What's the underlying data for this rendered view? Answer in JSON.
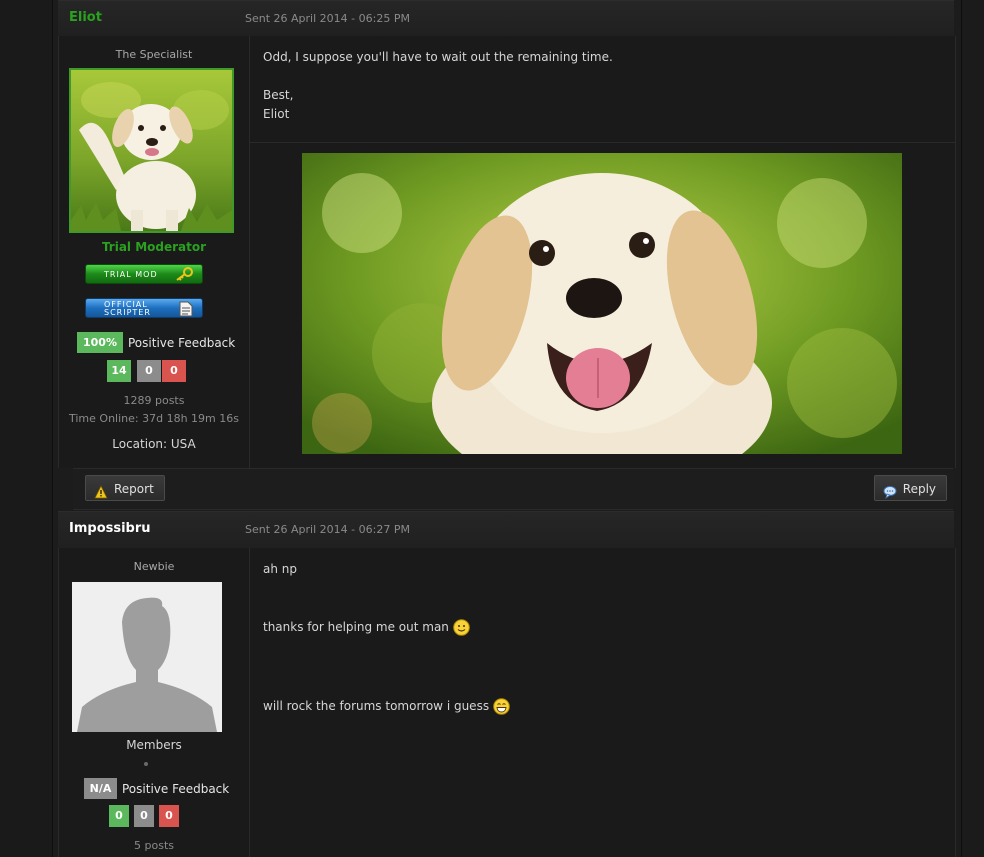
{
  "posts": [
    {
      "author": "Eliot",
      "author_color": "#2aa11f",
      "sent": "Sent 26 April 2014 - 06:25 PM",
      "user_title": "The Specialist",
      "group": "Trial Moderator",
      "group_color": "#2aa11f",
      "badges": [
        "TRIAL MOD",
        "OFFICIAL SCRIPTER"
      ],
      "feedback_pct": "100%",
      "feedback_label": "Positive Feedback",
      "rep_positive": "14",
      "rep_neutral": "0",
      "rep_negative": "0",
      "posts_count": "1289 posts",
      "time_online": "Time Online: 37d 18h 19m 16s",
      "location": "Location: USA",
      "message": "Odd, I suppose you'll have to wait out the remaining time.\n\nBest,\nEliot",
      "buttons": {
        "report": "Report",
        "reply": "Reply"
      }
    },
    {
      "author": "Impossibru",
      "author_color": "#ffffff",
      "sent": "Sent 26 April 2014 - 06:27 PM",
      "user_title": "Newbie",
      "group": "Members",
      "feedback_pct": "N/A",
      "feedback_label": "Positive Feedback",
      "rep_positive": "0",
      "rep_neutral": "0",
      "rep_negative": "0",
      "posts_count": "5 posts",
      "message_lines": [
        "ah np",
        "thanks for helping me out man",
        "will rock the forums tomorrow i guess"
      ]
    }
  ],
  "colors": {
    "positive": "#5cb85c",
    "neutral": "#8c8c8c",
    "negative": "#d9534f",
    "na": "#8c8c8c"
  },
  "icons": [
    "warning-icon",
    "speech-bubble-icon",
    "key-icon",
    "document-icon",
    "smiley-icon",
    "grin-icon"
  ]
}
